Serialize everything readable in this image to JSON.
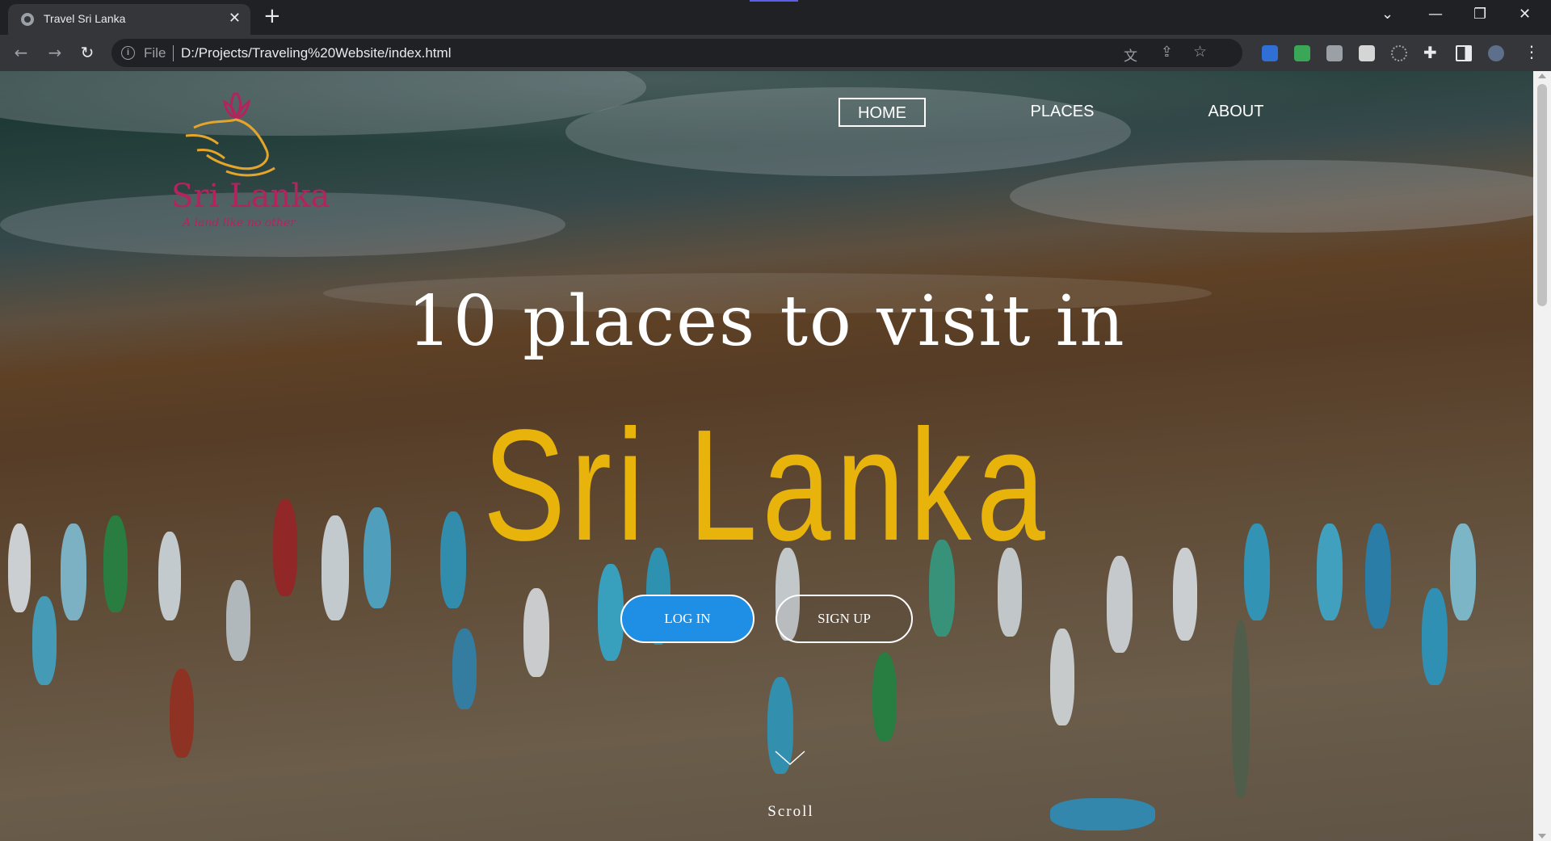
{
  "browser": {
    "tab_title": "Travel Sri Lanka",
    "scheme": "File",
    "url": "D:/Projects/Traveling%20Website/index.html"
  },
  "site": {
    "logo_text": "Sri Lanka",
    "logo_tagline": "A land like no other",
    "nav": [
      {
        "label": "HOME"
      },
      {
        "label": "PLACES"
      },
      {
        "label": "ABOUT"
      }
    ],
    "headline": "10 places to visit in",
    "headline_name": "Sri Lanka",
    "login_label": "LOG IN",
    "signup_label": "SIGN UP",
    "scroll_label": "Scroll"
  },
  "colors": {
    "accent_gold": "#e8b40c",
    "login_blue": "#1f8fe6",
    "logo_magenta": "#b3245e"
  }
}
